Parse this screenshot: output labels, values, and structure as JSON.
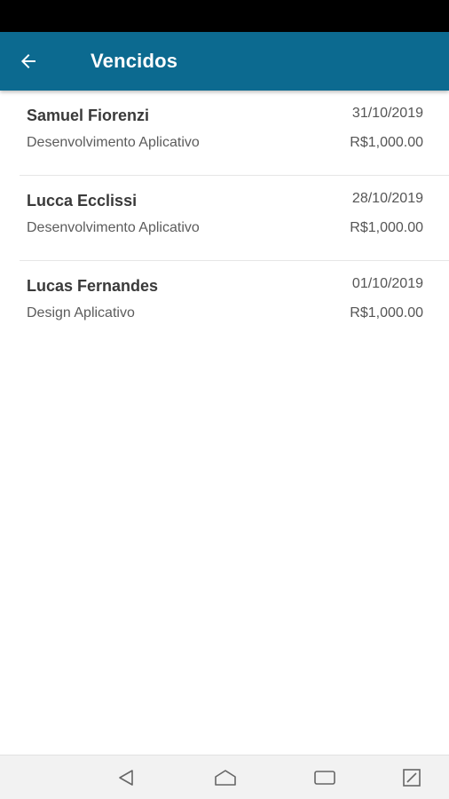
{
  "header": {
    "title": "Vencidos",
    "background_color": "#0c6a90",
    "back_icon": "arrow-left-icon"
  },
  "items": [
    {
      "name": "Samuel Fiorenzi",
      "date": "31/10/2019",
      "description": "Desenvolvimento Aplicativo",
      "amount": "R$1,000.00"
    },
    {
      "name": "Lucca Ecclissi",
      "date": "28/10/2019",
      "description": "Desenvolvimento Aplicativo",
      "amount": "R$1,000.00"
    },
    {
      "name": "Lucas Fernandes",
      "date": "01/10/2019",
      "description": "Design Aplicativo",
      "amount": "R$1,000.00"
    }
  ],
  "nav": {
    "icons": [
      "back-triangle-icon",
      "home-icon",
      "recents-icon",
      "screen-toggle-icon"
    ]
  }
}
